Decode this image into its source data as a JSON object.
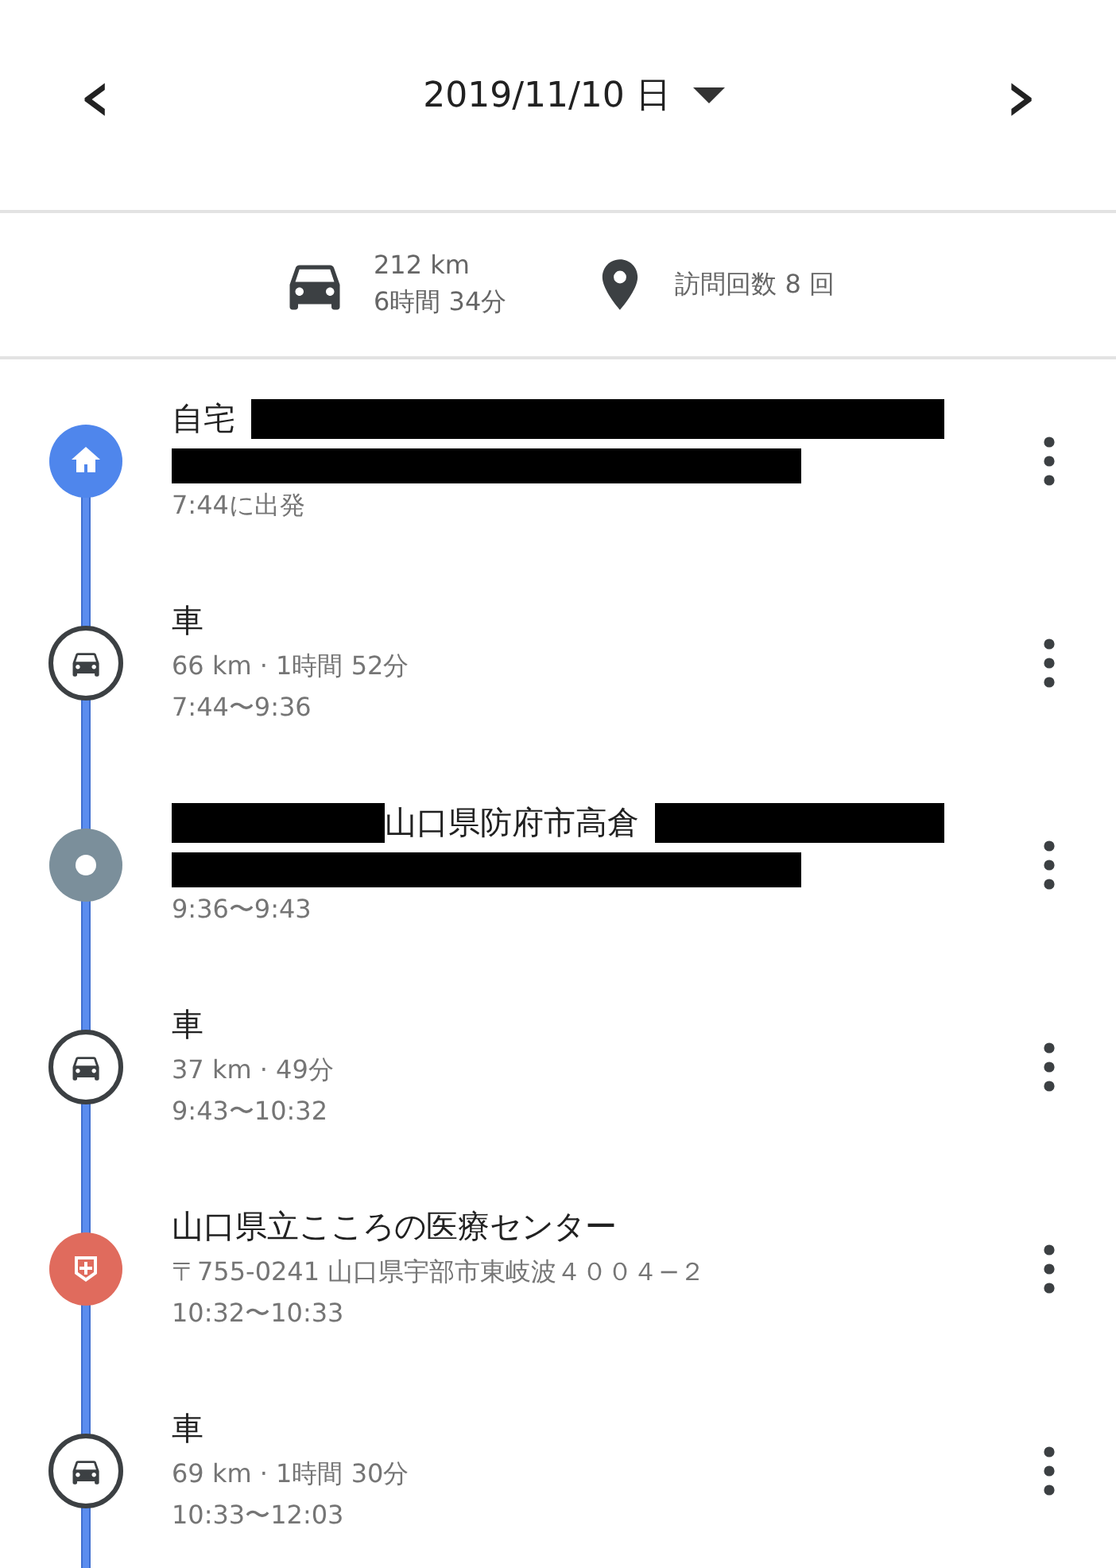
{
  "header": {
    "prev": "‹",
    "date": "2019/11/10 日",
    "next": "›"
  },
  "summary": {
    "distance": "212 km",
    "duration": "6時間 34分",
    "visits": "訪問回数 8 回"
  },
  "timeline": [
    {
      "kind": "home",
      "title": [
        {
          "kind": "text",
          "text": "自宅"
        },
        {
          "kind": "redacted"
        }
      ],
      "lines": [
        [
          {
            "kind": "redacted"
          }
        ]
      ],
      "time": "7:44に出発"
    },
    {
      "kind": "drive",
      "title": [
        {
          "kind": "text",
          "text": "車"
        }
      ],
      "lines": [
        [
          {
            "kind": "text",
            "text": "66 km · 1時間 52分"
          }
        ]
      ],
      "time": "7:44〜9:36"
    },
    {
      "kind": "place",
      "title": [
        {
          "kind": "redacted"
        },
        {
          "kind": "text",
          "text": "山口県防府市高倉"
        },
        {
          "kind": "redacted"
        }
      ],
      "lines": [
        [
          {
            "kind": "redacted"
          }
        ]
      ],
      "time": "9:36〜9:43"
    },
    {
      "kind": "drive",
      "title": [
        {
          "kind": "text",
          "text": "車"
        }
      ],
      "lines": [
        [
          {
            "kind": "text",
            "text": "37 km · 49分"
          }
        ]
      ],
      "time": "9:43〜10:32"
    },
    {
      "kind": "hospital",
      "title": [
        {
          "kind": "text",
          "text": "山口県立こころの医療センター"
        }
      ],
      "lines": [
        [
          {
            "kind": "text",
            "text": "〒755-0241 山口県宇部市東岐波４００４−２"
          }
        ]
      ],
      "time": "10:32〜10:33"
    },
    {
      "kind": "drive",
      "title": [
        {
          "kind": "text",
          "text": "車"
        }
      ],
      "lines": [
        [
          {
            "kind": "text",
            "text": "69 km · 1時間 30分"
          }
        ]
      ],
      "time": "10:33〜12:03"
    }
  ]
}
